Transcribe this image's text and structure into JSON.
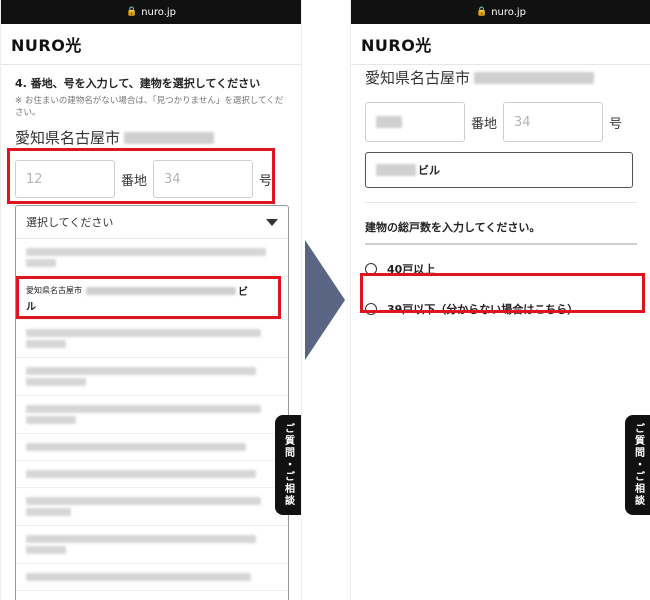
{
  "url": "nuro.jp",
  "logo": "NURO光",
  "left": {
    "step_title": "4. 番地、号を入力して、建物を選択してください",
    "note": "※ お住まいの建物名がない場合は、「見つかりません」を選択してください。",
    "prefecture": "愛知県名古屋市",
    "banchi_placeholder": "12",
    "banchi_label": "番地",
    "go_placeholder": "34",
    "go_label": "号",
    "select_label": "選択してください",
    "selected_prefix": "愛知県名古屋市",
    "selected_suffix_line1": "ビ",
    "selected_suffix_line2": "ル"
  },
  "right": {
    "prefecture": "愛知県名古屋市",
    "go_placeholder": "34",
    "banchi_label": "番地",
    "go_label": "号",
    "building_suffix": "ビル",
    "question": "建物の総戸数を入力してください。",
    "option_40": "40戸以上",
    "option_39": "39戸以下（分からない場合はこちら）"
  },
  "chat_button": "ご質問・ご相談",
  "colors": {
    "highlight": "#e0141e",
    "arrow": "#5a6584",
    "chat": "#111111"
  }
}
